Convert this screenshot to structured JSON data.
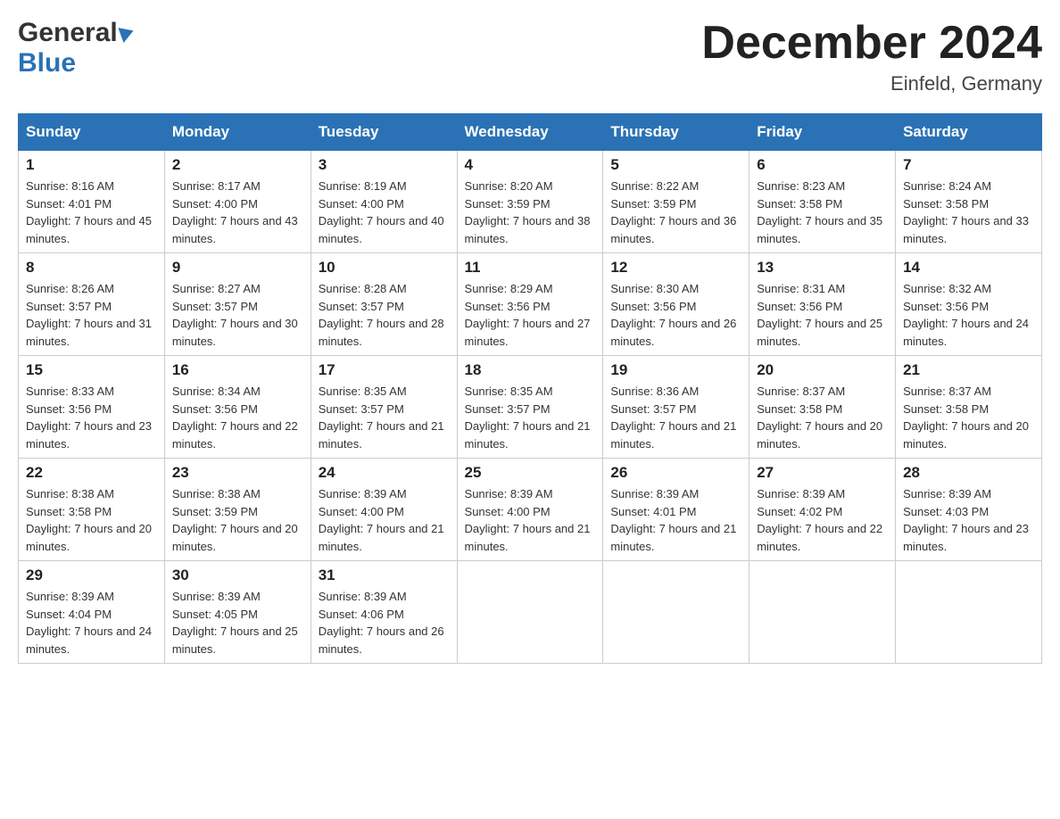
{
  "header": {
    "logo_general": "General",
    "logo_blue": "Blue",
    "month_title": "December 2024",
    "location": "Einfeld, Germany"
  },
  "weekdays": [
    "Sunday",
    "Monday",
    "Tuesday",
    "Wednesday",
    "Thursday",
    "Friday",
    "Saturday"
  ],
  "weeks": [
    [
      {
        "day": "1",
        "sunrise": "8:16 AM",
        "sunset": "4:01 PM",
        "daylight": "7 hours and 45 minutes."
      },
      {
        "day": "2",
        "sunrise": "8:17 AM",
        "sunset": "4:00 PM",
        "daylight": "7 hours and 43 minutes."
      },
      {
        "day": "3",
        "sunrise": "8:19 AM",
        "sunset": "4:00 PM",
        "daylight": "7 hours and 40 minutes."
      },
      {
        "day": "4",
        "sunrise": "8:20 AM",
        "sunset": "3:59 PM",
        "daylight": "7 hours and 38 minutes."
      },
      {
        "day": "5",
        "sunrise": "8:22 AM",
        "sunset": "3:59 PM",
        "daylight": "7 hours and 36 minutes."
      },
      {
        "day": "6",
        "sunrise": "8:23 AM",
        "sunset": "3:58 PM",
        "daylight": "7 hours and 35 minutes."
      },
      {
        "day": "7",
        "sunrise": "8:24 AM",
        "sunset": "3:58 PM",
        "daylight": "7 hours and 33 minutes."
      }
    ],
    [
      {
        "day": "8",
        "sunrise": "8:26 AM",
        "sunset": "3:57 PM",
        "daylight": "7 hours and 31 minutes."
      },
      {
        "day": "9",
        "sunrise": "8:27 AM",
        "sunset": "3:57 PM",
        "daylight": "7 hours and 30 minutes."
      },
      {
        "day": "10",
        "sunrise": "8:28 AM",
        "sunset": "3:57 PM",
        "daylight": "7 hours and 28 minutes."
      },
      {
        "day": "11",
        "sunrise": "8:29 AM",
        "sunset": "3:56 PM",
        "daylight": "7 hours and 27 minutes."
      },
      {
        "day": "12",
        "sunrise": "8:30 AM",
        "sunset": "3:56 PM",
        "daylight": "7 hours and 26 minutes."
      },
      {
        "day": "13",
        "sunrise": "8:31 AM",
        "sunset": "3:56 PM",
        "daylight": "7 hours and 25 minutes."
      },
      {
        "day": "14",
        "sunrise": "8:32 AM",
        "sunset": "3:56 PM",
        "daylight": "7 hours and 24 minutes."
      }
    ],
    [
      {
        "day": "15",
        "sunrise": "8:33 AM",
        "sunset": "3:56 PM",
        "daylight": "7 hours and 23 minutes."
      },
      {
        "day": "16",
        "sunrise": "8:34 AM",
        "sunset": "3:56 PM",
        "daylight": "7 hours and 22 minutes."
      },
      {
        "day": "17",
        "sunrise": "8:35 AM",
        "sunset": "3:57 PM",
        "daylight": "7 hours and 21 minutes."
      },
      {
        "day": "18",
        "sunrise": "8:35 AM",
        "sunset": "3:57 PM",
        "daylight": "7 hours and 21 minutes."
      },
      {
        "day": "19",
        "sunrise": "8:36 AM",
        "sunset": "3:57 PM",
        "daylight": "7 hours and 21 minutes."
      },
      {
        "day": "20",
        "sunrise": "8:37 AM",
        "sunset": "3:58 PM",
        "daylight": "7 hours and 20 minutes."
      },
      {
        "day": "21",
        "sunrise": "8:37 AM",
        "sunset": "3:58 PM",
        "daylight": "7 hours and 20 minutes."
      }
    ],
    [
      {
        "day": "22",
        "sunrise": "8:38 AM",
        "sunset": "3:58 PM",
        "daylight": "7 hours and 20 minutes."
      },
      {
        "day": "23",
        "sunrise": "8:38 AM",
        "sunset": "3:59 PM",
        "daylight": "7 hours and 20 minutes."
      },
      {
        "day": "24",
        "sunrise": "8:39 AM",
        "sunset": "4:00 PM",
        "daylight": "7 hours and 21 minutes."
      },
      {
        "day": "25",
        "sunrise": "8:39 AM",
        "sunset": "4:00 PM",
        "daylight": "7 hours and 21 minutes."
      },
      {
        "day": "26",
        "sunrise": "8:39 AM",
        "sunset": "4:01 PM",
        "daylight": "7 hours and 21 minutes."
      },
      {
        "day": "27",
        "sunrise": "8:39 AM",
        "sunset": "4:02 PM",
        "daylight": "7 hours and 22 minutes."
      },
      {
        "day": "28",
        "sunrise": "8:39 AM",
        "sunset": "4:03 PM",
        "daylight": "7 hours and 23 minutes."
      }
    ],
    [
      {
        "day": "29",
        "sunrise": "8:39 AM",
        "sunset": "4:04 PM",
        "daylight": "7 hours and 24 minutes."
      },
      {
        "day": "30",
        "sunrise": "8:39 AM",
        "sunset": "4:05 PM",
        "daylight": "7 hours and 25 minutes."
      },
      {
        "day": "31",
        "sunrise": "8:39 AM",
        "sunset": "4:06 PM",
        "daylight": "7 hours and 26 minutes."
      },
      null,
      null,
      null,
      null
    ]
  ]
}
